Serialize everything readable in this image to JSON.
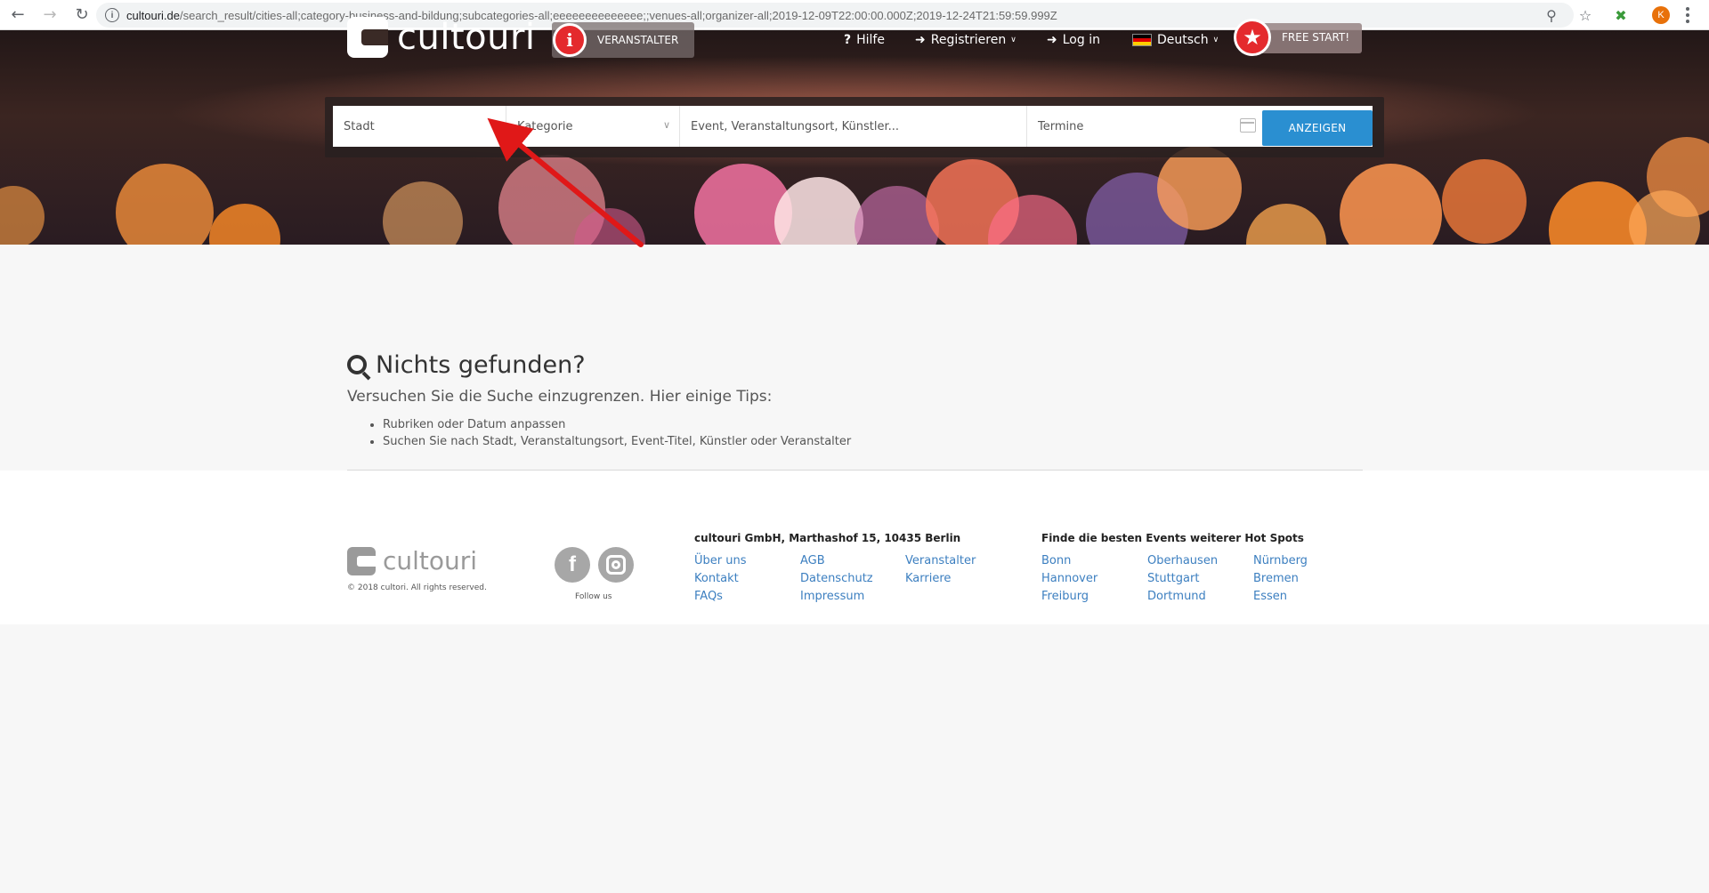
{
  "browser": {
    "url_domain": "cultouri.de",
    "url_path": "/search_result/cities-all;category-business-and-bildung;subcategories-all;eeeeeeeeeeeeee;;venues-all;organizer-all;2019-12-09T22:00:00.000Z;2019-12-24T21:59:59.999Z",
    "profile_initial": "K"
  },
  "header": {
    "logo_text": "cultouri",
    "veranstalter_label": "VERANSTALTER",
    "hilfe_label": "Hilfe",
    "registrieren_label": "Registrieren",
    "login_label": "Log in",
    "language_label": "Deutsch",
    "free_start_label": "FREE START!"
  },
  "search": {
    "city_placeholder": "Stadt",
    "category_placeholder": "Kategorie",
    "query_placeholder": "Event, Veranstaltungsort, Künstler...",
    "dates_placeholder": "Termine",
    "submit_label": "ANZEIGEN"
  },
  "results": {
    "title": "Nichts gefunden?",
    "subtitle": "Versuchen Sie die Suche einzugrenzen. Hier einige Tips:",
    "tips": [
      "Rubriken oder Datum anpassen",
      "Suchen Sie nach Stadt, Veranstaltungsort, Event-Titel, Künstler oder Veranstalter"
    ]
  },
  "footer": {
    "logo_text": "cultouri",
    "copyright": "© 2018 cultori. All rights reserved.",
    "follow_label": "Follow us",
    "address_heading": "cultouri GmbH, Marthashof 15, 10435 Berlin",
    "links_col1": [
      "Über uns",
      "Kontakt",
      "FAQs"
    ],
    "links_col2": [
      "AGB",
      "Datenschutz",
      "Impressum"
    ],
    "links_col3": [
      "Veranstalter",
      "Karriere"
    ],
    "hotspots_heading": "Finde die besten Events weiterer Hot Spots",
    "cities_col1": [
      "Bonn",
      "Hannover",
      "Freiburg"
    ],
    "cities_col2": [
      "Oberhausen",
      "Stuttgart",
      "Dortmund"
    ],
    "cities_col3": [
      "Nürnberg",
      "Bremen",
      "Essen"
    ]
  },
  "colors": {
    "accent_blue": "#2a8fd1",
    "brand_red": "#e42a2d",
    "link_blue": "#3c7fc0"
  }
}
